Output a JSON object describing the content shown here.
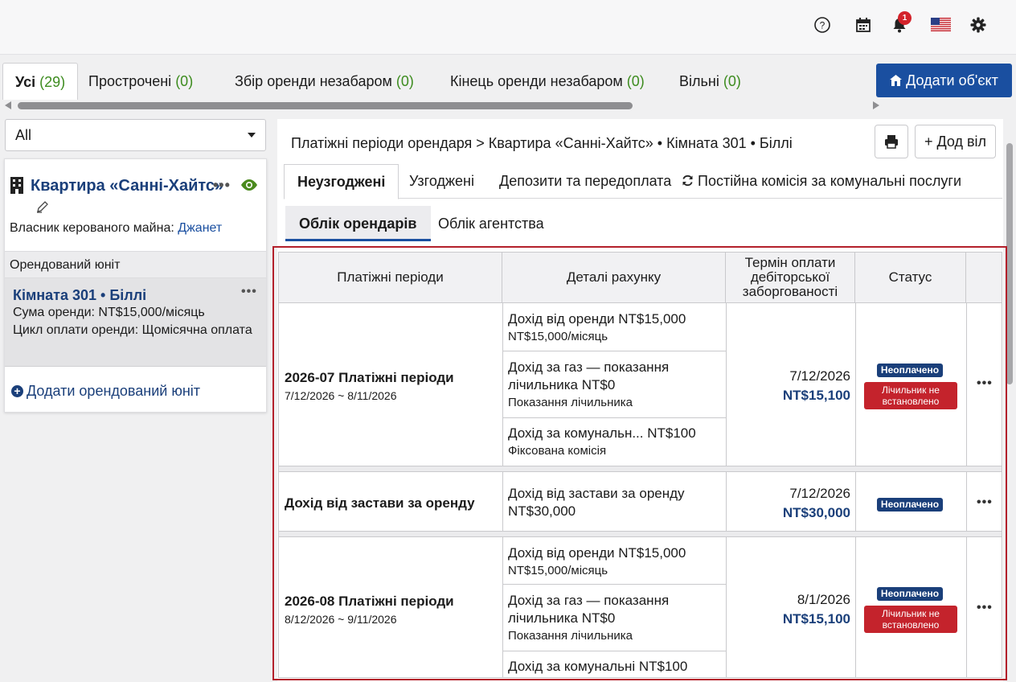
{
  "topbar": {
    "help": "help-icon",
    "calendar": "calendar-icon",
    "notifications_count": "1",
    "language": "us-flag-icon",
    "settings": "gear-icon"
  },
  "tabs": [
    {
      "label": "Усі",
      "count": "(29)"
    },
    {
      "label": "Прострочені",
      "count": "(0)"
    },
    {
      "label": "Збір оренди незабаром",
      "count": "(0)"
    },
    {
      "label": "Кінець оренди незабаром",
      "count": "(0)"
    },
    {
      "label": "Вільні",
      "count": "(0)"
    }
  ],
  "add_property_label": "Додати об'єкт",
  "filter": {
    "selected": "All"
  },
  "property": {
    "title": "Квартира «Санні-Хайтс»",
    "owner_label": "Власник керованого майна:",
    "owner_name": "Джанет",
    "units_header": "Орендований юніт",
    "unit": {
      "name": "Кімната 301 • Біллі",
      "rent": "Сума оренди: NT$15,000/місяць",
      "cycle": "Цикл оплати оренди: Щомісячна оплата"
    },
    "add_unit_label": "Додати орендований юніт"
  },
  "main": {
    "breadcrumb": "Платіжні періоди орендаря > Квартира «Санні-Хайтс» • Кімната 301 • Біллі",
    "add_button": "+ Дод віл",
    "tabs": [
      "Неузгоджені",
      "Узгоджені",
      "Депозити та передоплата",
      "Постійна комісія за комунальні послуги"
    ],
    "subtabs": [
      "Облік орендарів",
      "Облік агентства"
    ],
    "table": {
      "headers": [
        "Платіжні періоди",
        "Деталі рахунку",
        "Термін оплати дебіторської заборгованості",
        "Статус",
        ""
      ],
      "rows": [
        {
          "period": "2026-07 Платіжні періоди",
          "dates": "7/12/2026 ~ 8/11/2026",
          "details": [
            {
              "main": "Дохід від оренди NT$15,000",
              "sub": "NT$15,000/місяць"
            },
            {
              "main": "Дохід за газ — показання",
              "main2": "лічильника NT$0",
              "sub": "Показання лічильника"
            },
            {
              "main": "Дохід за комунальн... NT$100",
              "sub": "Фіксована комісія"
            }
          ],
          "due_date": "7/12/2026",
          "due_amount": "NT$15,100",
          "status": "Неоплачено",
          "meter": "Лічильник не встановлено"
        },
        {
          "period": "Дохід від застави за оренду",
          "details": [
            {
              "main": "Дохід від застави за оренду",
              "main2": "NT$30,000"
            }
          ],
          "due_date": "7/12/2026",
          "due_amount": "NT$30,000",
          "status": "Неоплачено"
        },
        {
          "period": "2026-08 Платіжні періоди",
          "dates": "8/12/2026 ~ 9/11/2026",
          "details": [
            {
              "main": "Дохід від оренди NT$15,000",
              "sub": "NT$15,000/місяць"
            },
            {
              "main": "Дохід за газ — показання",
              "main2": "лічильника NT$0",
              "sub": "Показання лічильника"
            },
            {
              "main": "Дохід за комунальні NT$100"
            }
          ],
          "due_date": "8/1/2026",
          "due_amount": "NT$15,100",
          "status": "Неоплачено",
          "meter": "Лічильник не встановлено"
        }
      ]
    }
  }
}
